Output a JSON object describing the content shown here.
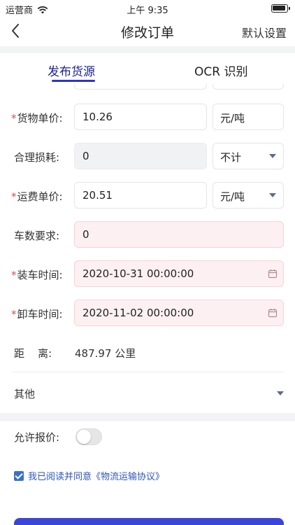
{
  "status_bar": {
    "carrier": "运营商",
    "time": "上午 9:35"
  },
  "nav": {
    "title": "修改订单",
    "right_action": "默认设置"
  },
  "tabs": [
    {
      "label": "发布货源",
      "active": true
    },
    {
      "label": "OCR 识别",
      "active": false
    }
  ],
  "form": {
    "cargo_unit_price": {
      "label": "货物单价:",
      "required": true,
      "value": "10.26",
      "unit": "元/吨"
    },
    "reasonable_loss": {
      "label": "合理损耗:",
      "required": false,
      "value": "0",
      "unit": "不计"
    },
    "freight_unit_price": {
      "label": "运费单价:",
      "required": true,
      "value": "20.51",
      "unit": "元/吨"
    },
    "vehicle_count": {
      "label": "车数要求:",
      "required": false,
      "value": "0"
    },
    "loading_time": {
      "label": "装车时间:",
      "required": true,
      "value": "2020-10-31 00:00:00"
    },
    "unloading_time": {
      "label": "卸车时间:",
      "required": true,
      "value": "2020-11-02 00:00:00"
    },
    "distance": {
      "label": "距    离:",
      "value": "487.97 公里"
    },
    "other": {
      "label": "其他"
    },
    "allow_quote": {
      "label": "允许报价:",
      "enabled": false
    }
  },
  "agreement": {
    "text": "我已阅读并同意《物流运输协议》",
    "checked": true
  },
  "colors": {
    "accent": "#2e34c8",
    "required": "#e34b4b",
    "pink_field": "#fdf0f2",
    "link": "#2f55b8",
    "button": "#3b45d9"
  }
}
